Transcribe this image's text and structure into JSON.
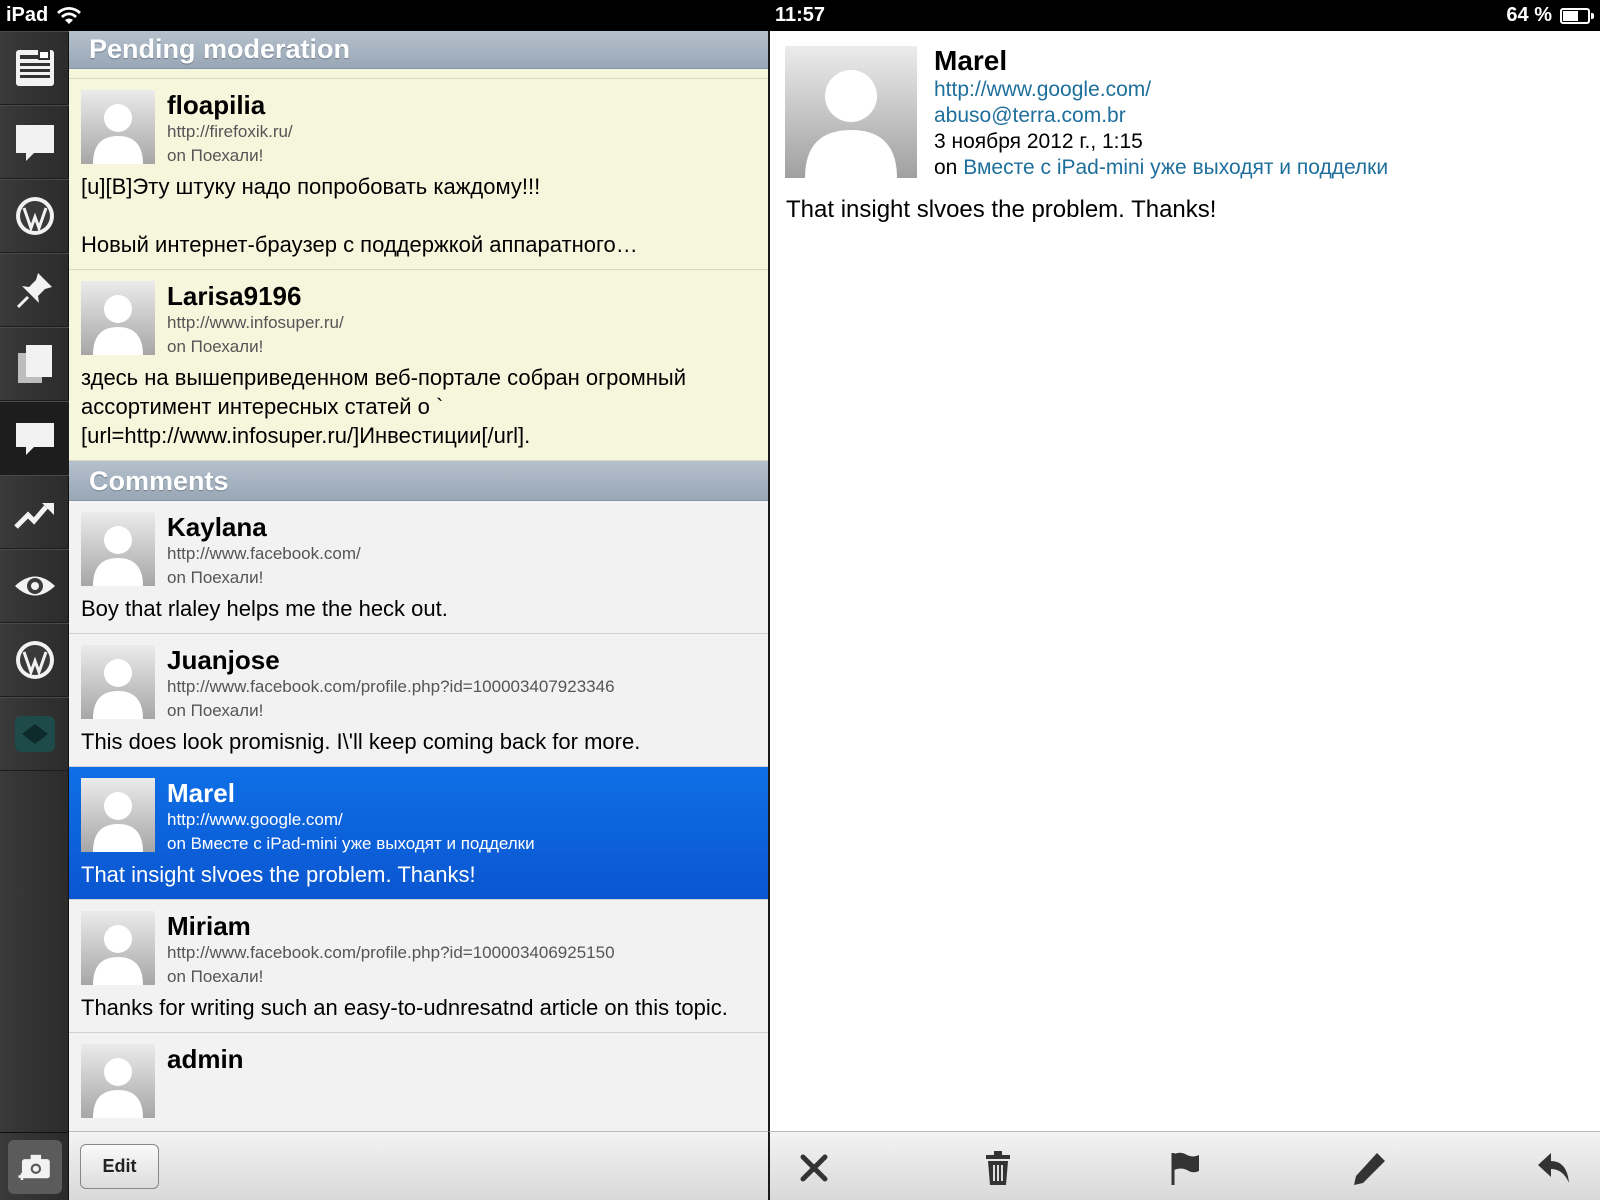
{
  "status_bar": {
    "device": "iPad",
    "time": "11:57",
    "battery": "64 %",
    "battery_level": 0.64
  },
  "sidebar": {
    "items": [
      {
        "icon": "reader-icon",
        "active": false
      },
      {
        "icon": "speech-bubble-icon",
        "active": false
      },
      {
        "icon": "wordpress-icon",
        "active": false
      },
      {
        "icon": "pushpin-icon",
        "active": false
      },
      {
        "icon": "pages-icon",
        "active": false
      },
      {
        "icon": "comments-icon",
        "active": true
      },
      {
        "icon": "stats-icon",
        "active": false
      },
      {
        "icon": "eye-icon",
        "active": false
      },
      {
        "icon": "wordpress-icon",
        "active": false
      },
      {
        "icon": "blog-switch-icon",
        "active": false
      }
    ],
    "camera_icon": "camera-plus-icon"
  },
  "list": {
    "pending_header": "Pending moderation",
    "comments_header": "Comments",
    "pending": [
      {
        "author": "floapilia",
        "url": "http://firefoxik.ru/",
        "on": "on Поехали!",
        "body": "[u][B]Эту штуку надо попробовать каждому!!!\n\nНовый интернет-браузер с поддержкой аппаратного…"
      },
      {
        "author": "Larisa9196",
        "url": "http://www.infosuper.ru/",
        "on": "on Поехали!",
        "body": "здесь на вышеприведенном веб-портале собран огромный ассортимент интересных статей о `\n[url=http://www.infosuper.ru/]Инвестиции[/url]."
      }
    ],
    "comments": [
      {
        "author": "Kaylana",
        "url": "http://www.facebook.com/",
        "on": "on Поехали!",
        "body": "Boy that rlaley helps me the heck out.",
        "selected": false
      },
      {
        "author": "Juanjose",
        "url": "http://www.facebook.com/profile.php?id=100003407923346",
        "on": "on Поехали!",
        "body": "This does look promisnig. I\\'ll keep coming back for more.",
        "selected": false
      },
      {
        "author": "Marel",
        "url": "http://www.google.com/",
        "on": "on Вместе с iPad-mini уже выходят и подделки",
        "body": "That insight slvoes the problem. Thanks!",
        "selected": true
      },
      {
        "author": "Miriam",
        "url": "http://www.facebook.com/profile.php?id=100003406925150",
        "on": "on Поехали!",
        "body": "Thanks for writing such an easy-to-udnresatnd article on this topic.",
        "selected": false
      },
      {
        "author": "admin",
        "url": "",
        "on": "",
        "body": "",
        "selected": false
      }
    ],
    "edit_label": "Edit"
  },
  "detail": {
    "author": "Marel",
    "url": "http://www.google.com/",
    "email": "abuso@terra.com.br",
    "date": "3 ноября 2012 г., 1:15",
    "on_prefix": "on",
    "post_title": "Вместе с iPad-mini уже выходят и подделки",
    "body": "That insight slvoes the problem. Thanks!"
  },
  "toolbar": {
    "buttons": [
      "close-icon",
      "trash-icon",
      "flag-icon",
      "pencil-icon",
      "reply-icon"
    ]
  },
  "colors": {
    "selected_row": "#0f6fe6",
    "pending_bg": "#f6f6dd",
    "link": "#1f6f9c",
    "section_header": "#a6b2c0"
  }
}
